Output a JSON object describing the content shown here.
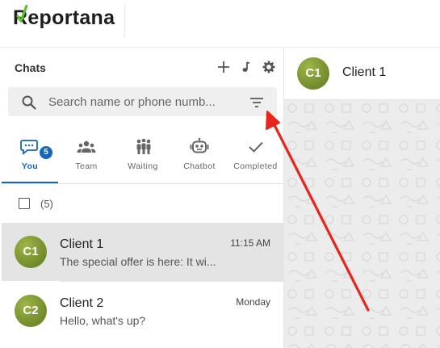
{
  "app": {
    "logo_text": "Reportana"
  },
  "sidebar": {
    "title": "Chats",
    "search": {
      "placeholder": "Search name or phone numb..."
    },
    "tabs": [
      {
        "label": "You",
        "icon": "chat-bubble-icon",
        "badge": "5",
        "active": true
      },
      {
        "label": "Team",
        "icon": "group-icon"
      },
      {
        "label": "Waiting",
        "icon": "people-waiting-icon"
      },
      {
        "label": "Chatbot",
        "icon": "robot-icon"
      },
      {
        "label": "Completed",
        "icon": "checkmark-icon"
      }
    ],
    "select_count": "(5)",
    "chats": [
      {
        "initials": "C1",
        "name": "Client 1",
        "preview": "The special offer is here: It wi...",
        "time": "11:15 AM",
        "selected": true
      },
      {
        "initials": "C2",
        "name": "Client 2",
        "preview": "Hello, what's up?",
        "time": "Monday",
        "selected": false
      }
    ]
  },
  "conversation": {
    "initials": "C1",
    "name": "Client 1"
  },
  "colors": {
    "accent": "#1565c0",
    "avatar": "#7f9a33",
    "annotation_arrow": "#e8241c"
  }
}
